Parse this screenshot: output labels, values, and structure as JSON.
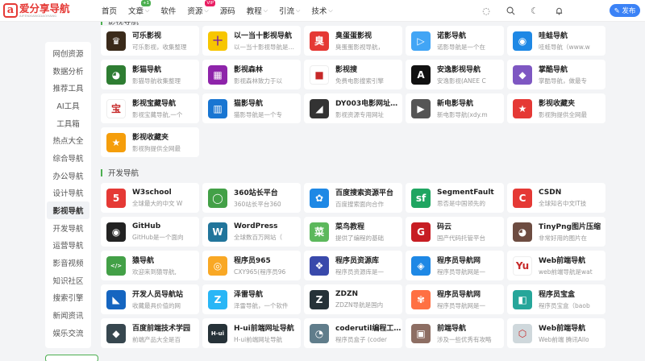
{
  "header": {
    "logo_title": "爱分享导航",
    "logo_sub": "AIFENXIANGDAOHANG",
    "nav": [
      {
        "label": "首页",
        "badge": "",
        "caret": false
      },
      {
        "label": "文章",
        "badge": "+1",
        "caret": true
      },
      {
        "label": "软件",
        "badge": "",
        "caret": false
      },
      {
        "label": "资源",
        "badge": "VIP",
        "caret": true
      },
      {
        "label": "源码",
        "badge": "",
        "caret": false
      },
      {
        "label": "教程",
        "badge": "",
        "caret": true
      },
      {
        "label": "引流",
        "badge": "",
        "caret": true
      },
      {
        "label": "技术",
        "badge": "",
        "caret": true
      }
    ],
    "publish_label": "✎ 发布"
  },
  "sidebar": {
    "items": [
      "网创资源",
      "数据分析",
      "推荐工具",
      "AI工具",
      "工具箱",
      "热点大全",
      "综合导航",
      "办公导航",
      "设计导航",
      "影视导航",
      "开发导航",
      "运营导航",
      "影音视频",
      "知识社区",
      "搜索引擎",
      "新闻资讯",
      "娱乐交流"
    ],
    "active": "影视导航"
  },
  "sections": [
    {
      "title": "影视导航",
      "cards": [
        {
          "title": "可乐影视",
          "desc": "可乐影视，收集整理",
          "icon": "♛",
          "bg": "#3a2a1a"
        },
        {
          "title": "以一当十影视导航",
          "desc": "以一当十影视导航是一个",
          "icon": "十",
          "bg": "#f7c600"
        },
        {
          "title": "臭蛋蛋影视",
          "desc": "臭蛋蛋影视导航，",
          "icon": "臭",
          "bg": "#e53935"
        },
        {
          "title": "诺影导航",
          "desc": "诺影导航是一个在",
          "icon": "▷",
          "bg": "#42a5f5"
        },
        {
          "title": "哇蛙导航",
          "desc": "哇蛙导航（www.w",
          "icon": "◉",
          "bg": "#1e88e5"
        },
        {
          "title": "影猫导航",
          "desc": "影猫导航收集整理",
          "icon": "◕",
          "bg": "#2e7d32"
        },
        {
          "title": "影视森林",
          "desc": "影视森林致力于以",
          "icon": "▦",
          "bg": "#8e24aa"
        },
        {
          "title": "影视搜",
          "desc": "免费电影搜索引擎",
          "icon": "■",
          "bg": "#ffffff"
        },
        {
          "title": "安逸影视导航",
          "desc": "安逸影视(ANEE C",
          "icon": "A",
          "bg": "#111111"
        },
        {
          "title": "掌酷导航",
          "desc": "掌酷导航，做最专",
          "icon": "◆",
          "bg": "#7e57c2"
        },
        {
          "title": "影视宝藏导航",
          "desc": "影视宝藏导航,一个",
          "icon": "宝",
          "bg": "#ffffff"
        },
        {
          "title": "猫影导航",
          "desc": "猫影导航是一个专",
          "icon": "▥",
          "bg": "#1976d2"
        },
        {
          "title": "DY003电影网址…",
          "desc": "影视资源专用网址",
          "icon": "◢",
          "bg": "#333333"
        },
        {
          "title": "新电影导航",
          "desc": "新电影导航(xdy.m",
          "icon": "▶",
          "bg": "#555555"
        },
        {
          "title": "影视收藏夹",
          "desc": "影视狗提供全网最",
          "icon": "★",
          "bg": "#e53935"
        },
        {
          "title": "影视收藏夹",
          "desc": "影视狗提供全网最",
          "icon": "★",
          "bg": "#f59e0b"
        }
      ]
    },
    {
      "title": "开发导航",
      "cards": [
        {
          "title": "W3school",
          "desc": "全球最大的中文 W",
          "icon": "5",
          "bg": "#e53935"
        },
        {
          "title": "360站长平台",
          "desc": "360站长平台360",
          "icon": "◯",
          "bg": "#43a047"
        },
        {
          "title": "百度搜索资源平台",
          "desc": "百度搜索面向合作",
          "icon": "✿",
          "bg": "#1e88e5"
        },
        {
          "title": "SegmentFault",
          "desc": "思否是中国领先的",
          "icon": "sf",
          "bg": "#1fa561"
        },
        {
          "title": "CSDN",
          "desc": "全球知名中文IT技",
          "icon": "C",
          "bg": "#e53935"
        },
        {
          "title": "GitHub",
          "desc": "GitHub是一个面向",
          "icon": "◉",
          "bg": "#222222"
        },
        {
          "title": "WordPress",
          "desc": "全球数百万网站（",
          "icon": "W",
          "bg": "#21759b"
        },
        {
          "title": "菜鸟教程",
          "desc": "提供了编程的基础",
          "icon": "菜",
          "bg": "#5cb85c"
        },
        {
          "title": "码云",
          "desc": "国产代码托管平台",
          "icon": "G",
          "bg": "#c71d23"
        },
        {
          "title": "TinyPng图片压缩",
          "desc": "非常好用的图片在",
          "icon": "◕",
          "bg": "#6d4c41"
        },
        {
          "title": "猿导航",
          "desc": "欢迎来到猿导航,",
          "icon": "</>",
          "bg": "#43a047"
        },
        {
          "title": "程序员965",
          "desc": "CXY965(程序员96",
          "icon": "◎",
          "bg": "#f9a825"
        },
        {
          "title": "程序员资源库",
          "desc": "程序员资源库是一",
          "icon": "❖",
          "bg": "#3949ab"
        },
        {
          "title": "程序员导航网",
          "desc": "程序员导航网是一",
          "icon": "◈",
          "bg": "#1e88e5"
        },
        {
          "title": "Web前端导航",
          "desc": "web前端导航是wat",
          "icon": "Yu",
          "bg": "#ffffff"
        },
        {
          "title": "开发人员导航站",
          "desc": "收藏最具价值的网",
          "icon": "◣",
          "bg": "#1565c0"
        },
        {
          "title": "泽雷导航",
          "desc": "泽雷导航，一个软件",
          "icon": "Z",
          "bg": "#29b6f6"
        },
        {
          "title": "ZDZN",
          "desc": "ZDZN导航是国内",
          "icon": "Z",
          "bg": "#263238"
        },
        {
          "title": "程序员导航网",
          "desc": "程序员导航网是一",
          "icon": "✾",
          "bg": "#ff7043"
        },
        {
          "title": "程序员宝盒",
          "desc": "程序员宝盒（baob",
          "icon": "◧",
          "bg": "#26a69a"
        },
        {
          "title": "百度前端技术学园",
          "desc": "前端产品大全是百",
          "icon": "◆",
          "bg": "#37474f"
        },
        {
          "title": "H-ui前端网址导航",
          "desc": "H-ui前端网址导航",
          "icon": "H-ui",
          "bg": "#263238"
        },
        {
          "title": "coderutil编程工…",
          "desc": "程序员盒子 (coder",
          "icon": "◔",
          "bg": "#607d8b"
        },
        {
          "title": "前端导航",
          "desc": "涉及一些优秀有攻略",
          "icon": "▣",
          "bg": "#8d6e63"
        },
        {
          "title": "Web前端导航",
          "desc": "Web前端 腾讯Allo",
          "icon": "⬡",
          "bg": "#cfd8dc"
        }
      ]
    }
  ],
  "colors": {
    "accent": "#4caf50",
    "publish": "#3b82f6",
    "logo": "#e53935"
  }
}
